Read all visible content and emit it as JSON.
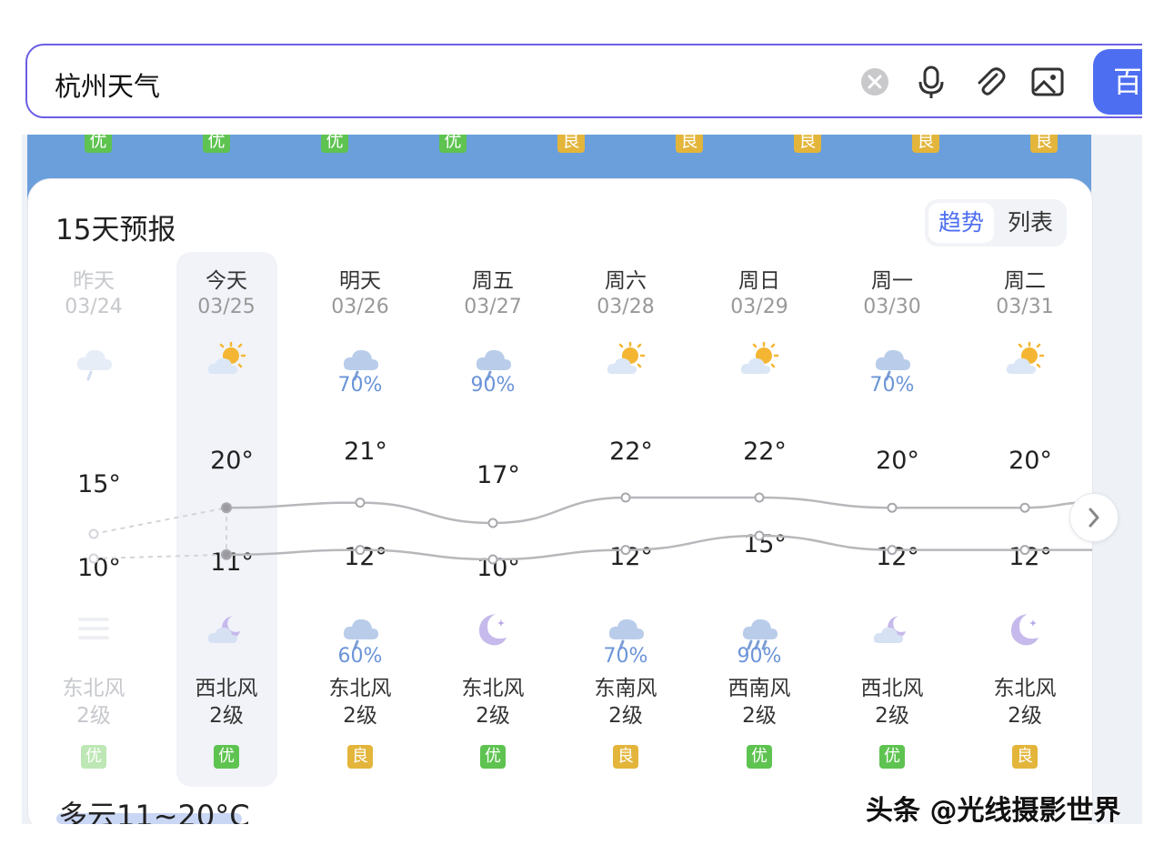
{
  "search": {
    "query": "杭州天气",
    "button_label": "百"
  },
  "aqi_strip": [
    "优",
    "优",
    "优",
    "优",
    "良",
    "良",
    "良",
    "良",
    "良"
  ],
  "forecast": {
    "title": "15天预报",
    "toggle": {
      "active": "趋势",
      "inactive": "列表"
    },
    "days": [
      {
        "day": "昨天",
        "date": "03/24",
        "day_icon": "rain-cloud-icon",
        "day_precip": "",
        "high": "15°",
        "low": "10°",
        "night_icon": "haze-icon",
        "night_precip": "",
        "wind_dir": "东北风",
        "wind_level": "2级",
        "aqi": "优",
        "aqi_level": "good",
        "past": true
      },
      {
        "day": "今天",
        "date": "03/25",
        "day_icon": "partly-sunny-icon",
        "day_precip": "",
        "high": "20°",
        "low": "11°",
        "night_icon": "moon-cloud-icon",
        "night_precip": "",
        "wind_dir": "西北风",
        "wind_level": "2级",
        "aqi": "优",
        "aqi_level": "good",
        "past": false
      },
      {
        "day": "明天",
        "date": "03/26",
        "day_icon": "rain-cloud-icon",
        "day_precip": "70%",
        "high": "21°",
        "low": "12°",
        "night_icon": "rain-cloud-icon",
        "night_precip": "60%",
        "wind_dir": "东北风",
        "wind_level": "2级",
        "aqi": "良",
        "aqi_level": "fair",
        "past": false
      },
      {
        "day": "周五",
        "date": "03/27",
        "day_icon": "rain-cloud-icon",
        "day_precip": "90%",
        "high": "17°",
        "low": "10°",
        "night_icon": "moon-star-icon",
        "night_precip": "",
        "wind_dir": "东北风",
        "wind_level": "2级",
        "aqi": "优",
        "aqi_level": "good",
        "past": false
      },
      {
        "day": "周六",
        "date": "03/28",
        "day_icon": "partly-sunny-icon",
        "day_precip": "",
        "high": "22°",
        "low": "12°",
        "night_icon": "rain-cloud-icon",
        "night_precip": "70%",
        "wind_dir": "东南风",
        "wind_level": "2级",
        "aqi": "良",
        "aqi_level": "fair",
        "past": false
      },
      {
        "day": "周日",
        "date": "03/29",
        "day_icon": "partly-sunny-icon",
        "day_precip": "",
        "high": "22°",
        "low": "15°",
        "night_icon": "heavy-rain-icon",
        "night_precip": "90%",
        "wind_dir": "西南风",
        "wind_level": "2级",
        "aqi": "优",
        "aqi_level": "good",
        "past": false
      },
      {
        "day": "周一",
        "date": "03/30",
        "day_icon": "rain-cloud-icon",
        "day_precip": "70%",
        "high": "20°",
        "low": "12°",
        "night_icon": "moon-cloud-icon",
        "night_precip": "",
        "wind_dir": "西北风",
        "wind_level": "2级",
        "aqi": "优",
        "aqi_level": "good",
        "past": false
      },
      {
        "day": "周二",
        "date": "03/31",
        "day_icon": "partly-sunny-icon",
        "day_precip": "",
        "high": "20°",
        "low": "12°",
        "night_icon": "moon-star-icon",
        "night_precip": "",
        "wind_dir": "东北风",
        "wind_level": "2级",
        "aqi": "良",
        "aqi_level": "fair",
        "past": false
      }
    ]
  },
  "summary": "多云11~20°C",
  "watermark": "头条 @光线摄影世界",
  "colors": {
    "accent": "#4e6ef2",
    "aqi_good": "#5ec350",
    "aqi_fair": "#e3b53b",
    "precip": "#6b94d8",
    "band": "#6a9fdb"
  }
}
